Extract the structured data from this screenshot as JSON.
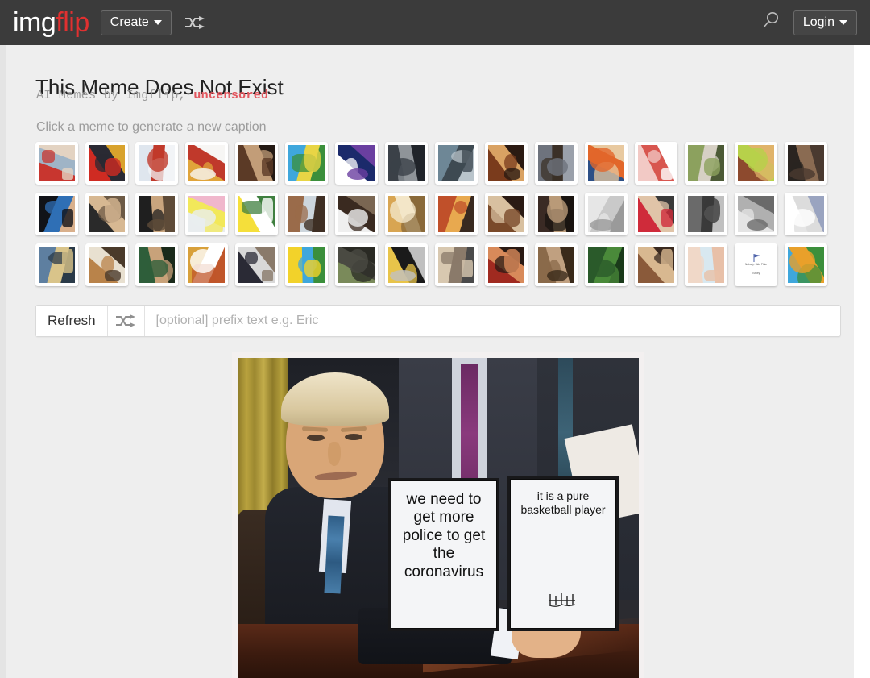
{
  "header": {
    "logo_primary": "img",
    "logo_accent": "flip",
    "create_label": "Create",
    "shuffle_icon": "shuffle-icon",
    "search_icon": "search-icon",
    "login_label": "Login",
    "background_color": "#3b3b3b",
    "accent_color": "#e03030"
  },
  "page": {
    "title": "This Meme Does Not Exist",
    "subtitle_prefix": "AI Memes by Imgflip, ",
    "subtitle_accent": "uncensored",
    "subtitle_accent_color": "#e2575f",
    "hint": "Click a meme to generate a new caption",
    "background_color": "#eeeeee"
  },
  "thumbnails": {
    "count": 48,
    "rows": 3,
    "per_row": 16,
    "items": [
      {
        "name": "distracted-boyfriend",
        "colors": [
          "#c8362f",
          "#9fb4c6",
          "#e3d3c2"
        ]
      },
      {
        "name": "angry-red-scene",
        "colors": [
          "#cf2b22",
          "#2a2a33",
          "#d8a22c"
        ]
      },
      {
        "name": "comic-panels",
        "colors": [
          "#dfe6ee",
          "#c0392b",
          "#f2f4f7"
        ]
      },
      {
        "name": "orange-figure",
        "colors": [
          "#e0a43a",
          "#c0392b",
          "#f7f6f4"
        ]
      },
      {
        "name": "long-hair-man",
        "colors": [
          "#5b3a26",
          "#c29d78",
          "#241a14"
        ]
      },
      {
        "name": "spongebob-cartoon",
        "colors": [
          "#3fa7dc",
          "#e8d545",
          "#3b8f3b"
        ]
      },
      {
        "name": "white-lines-nebula",
        "colors": [
          "#ffffff",
          "#1b2a6b",
          "#6a3fa0"
        ]
      },
      {
        "name": "dark-street-scene",
        "colors": [
          "#3b4148",
          "#8f9499",
          "#20242a"
        ]
      },
      {
        "name": "highway-photo",
        "colors": [
          "#6e8796",
          "#3e4a52",
          "#b9c4cb"
        ]
      },
      {
        "name": "man-in-suit-warm",
        "colors": [
          "#7a3b1c",
          "#d9a263",
          "#2b1a12"
        ]
      },
      {
        "name": "man-grey-background",
        "colors": [
          "#6e737d",
          "#3b3027",
          "#9aa0aa"
        ]
      },
      {
        "name": "futurama-fry",
        "colors": [
          "#2c4f86",
          "#e2672a",
          "#e8c9a0"
        ]
      },
      {
        "name": "pink-comic-strip",
        "colors": [
          "#f2c9c5",
          "#d8564f",
          "#ffffff"
        ]
      },
      {
        "name": "skeleton-bench",
        "colors": [
          "#8ca15e",
          "#d6d0c4",
          "#4c5a36"
        ]
      },
      {
        "name": "toy-story-buzz-woody",
        "colors": [
          "#8d4a2e",
          "#b7d14a",
          "#e0b36a"
        ]
      },
      {
        "name": "dark-interior-scene",
        "colors": [
          "#2a2420",
          "#8a6b52",
          "#4a3a30"
        ]
      },
      {
        "name": "hand-raised-dark",
        "colors": [
          "#111318",
          "#2f6fb5",
          "#d9b08c"
        ]
      },
      {
        "name": "man-tuxedo-applause",
        "colors": [
          "#2a2a2a",
          "#d7b892",
          "#6d5a45"
        ]
      },
      {
        "name": "leonardo-cheers",
        "colors": [
          "#1f1f1f",
          "#c9a57e",
          "#5e4b38"
        ]
      },
      {
        "name": "cartoon-pastel",
        "colors": [
          "#e9edef",
          "#f2e85a",
          "#f0b7cc"
        ]
      },
      {
        "name": "pikachu-surprised",
        "colors": [
          "#f5df3a",
          "#ffffff",
          "#3f7f3f"
        ]
      },
      {
        "name": "boy-window",
        "colors": [
          "#9a6b4a",
          "#cdd6dd",
          "#3f2f24"
        ]
      },
      {
        "name": "rabbit-table",
        "colors": [
          "#efefef",
          "#3a2a20",
          "#7a6652"
        ]
      },
      {
        "name": "doge-shiba",
        "colors": [
          "#d8a552",
          "#f3e6c8",
          "#8a6a3a"
        ]
      },
      {
        "name": "fire-background",
        "colors": [
          "#c0502a",
          "#e8a94f",
          "#3a2a20"
        ]
      },
      {
        "name": "han-solo-scene",
        "colors": [
          "#7a4a2a",
          "#d8c0a0",
          "#2a1a14"
        ]
      },
      {
        "name": "person-dark-room",
        "colors": [
          "#3a2a24",
          "#b99a78",
          "#1a1410"
        ]
      },
      {
        "name": "hand-white-grey",
        "colors": [
          "#e6e6e6",
          "#c9c9c9",
          "#9a9a9a"
        ]
      },
      {
        "name": "woman-red-arms-up",
        "colors": [
          "#cf2b3a",
          "#e0c4a8",
          "#3a3a3a"
        ]
      },
      {
        "name": "office-desk-scene",
        "colors": [
          "#6a6a6a",
          "#3a3a3a",
          "#c0c0c0"
        ]
      },
      {
        "name": "cat-profile",
        "colors": [
          "#e4e4e4",
          "#b0b0b0",
          "#6a6a6a"
        ]
      },
      {
        "name": "white-document",
        "colors": [
          "#ffffff",
          "#dcdcdc",
          "#9aa4c0"
        ]
      },
      {
        "name": "man-blue-shirt-office",
        "colors": [
          "#5e7fa0",
          "#d9c48a",
          "#2a3a48"
        ]
      },
      {
        "name": "child-eating",
        "colors": [
          "#b9834a",
          "#e8e0d0",
          "#4a3a2a"
        ]
      },
      {
        "name": "man-green-background",
        "colors": [
          "#2e5e3a",
          "#c8a27a",
          "#1a2a1a"
        ]
      },
      {
        "name": "orange-white-split",
        "colors": [
          "#d8a03a",
          "#ffffff",
          "#c0562a"
        ]
      },
      {
        "name": "man-podium",
        "colors": [
          "#2a2a35",
          "#d8d8d8",
          "#8a7a6a"
        ]
      },
      {
        "name": "spongebob-yellow",
        "colors": [
          "#f2d22a",
          "#3fa7dc",
          "#3b8f3b"
        ]
      },
      {
        "name": "yoda",
        "colors": [
          "#7a8a5a",
          "#4a4a42",
          "#2a2a24"
        ]
      },
      {
        "name": "abstract-yellow-black",
        "colors": [
          "#e8c44a",
          "#1a1a1a",
          "#c0c0c0"
        ]
      },
      {
        "name": "older-man-portrait",
        "colors": [
          "#d8c8b0",
          "#8a7a6a",
          "#4a4a4a"
        ]
      },
      {
        "name": "red-dramatic-scene",
        "colors": [
          "#a02a20",
          "#d88a5a",
          "#2a1a14"
        ]
      },
      {
        "name": "running-person",
        "colors": [
          "#8a6a4a",
          "#c0a080",
          "#3a2a1a"
        ]
      },
      {
        "name": "kermit-green",
        "colors": [
          "#2a5a2a",
          "#4a8a3a",
          "#1a3a1a"
        ]
      },
      {
        "name": "indoor-people-scene",
        "colors": [
          "#8a5a3a",
          "#d8b890",
          "#3a2a20"
        ]
      },
      {
        "name": "baby-bath-soft",
        "colors": [
          "#f0d8c8",
          "#d8e8f0",
          "#e8c0a8"
        ]
      },
      {
        "name": "nobody-flag-card",
        "colors": [
          "#ffffff",
          "#4a5fa8",
          "#888888"
        ],
        "label_top": "Nobody: Side Plate",
        "label_bottom": "Turkey",
        "is_text_card": true
      },
      {
        "name": "spongebob-patrick-scene",
        "colors": [
          "#3fa7dc",
          "#e8a02a",
          "#3b8f3b"
        ]
      }
    ]
  },
  "refresh_row": {
    "refresh_label": "Refresh",
    "shuffle_icon": "shuffle-icon",
    "prefix_placeholder": "[optional] prefix text e.g. Eric",
    "prefix_value": ""
  },
  "meme": {
    "template_name": "trump-bill-signing",
    "left_card_text": "we need to get more police to get the coronavirus",
    "right_card_text": "it is a pure basketball player"
  }
}
